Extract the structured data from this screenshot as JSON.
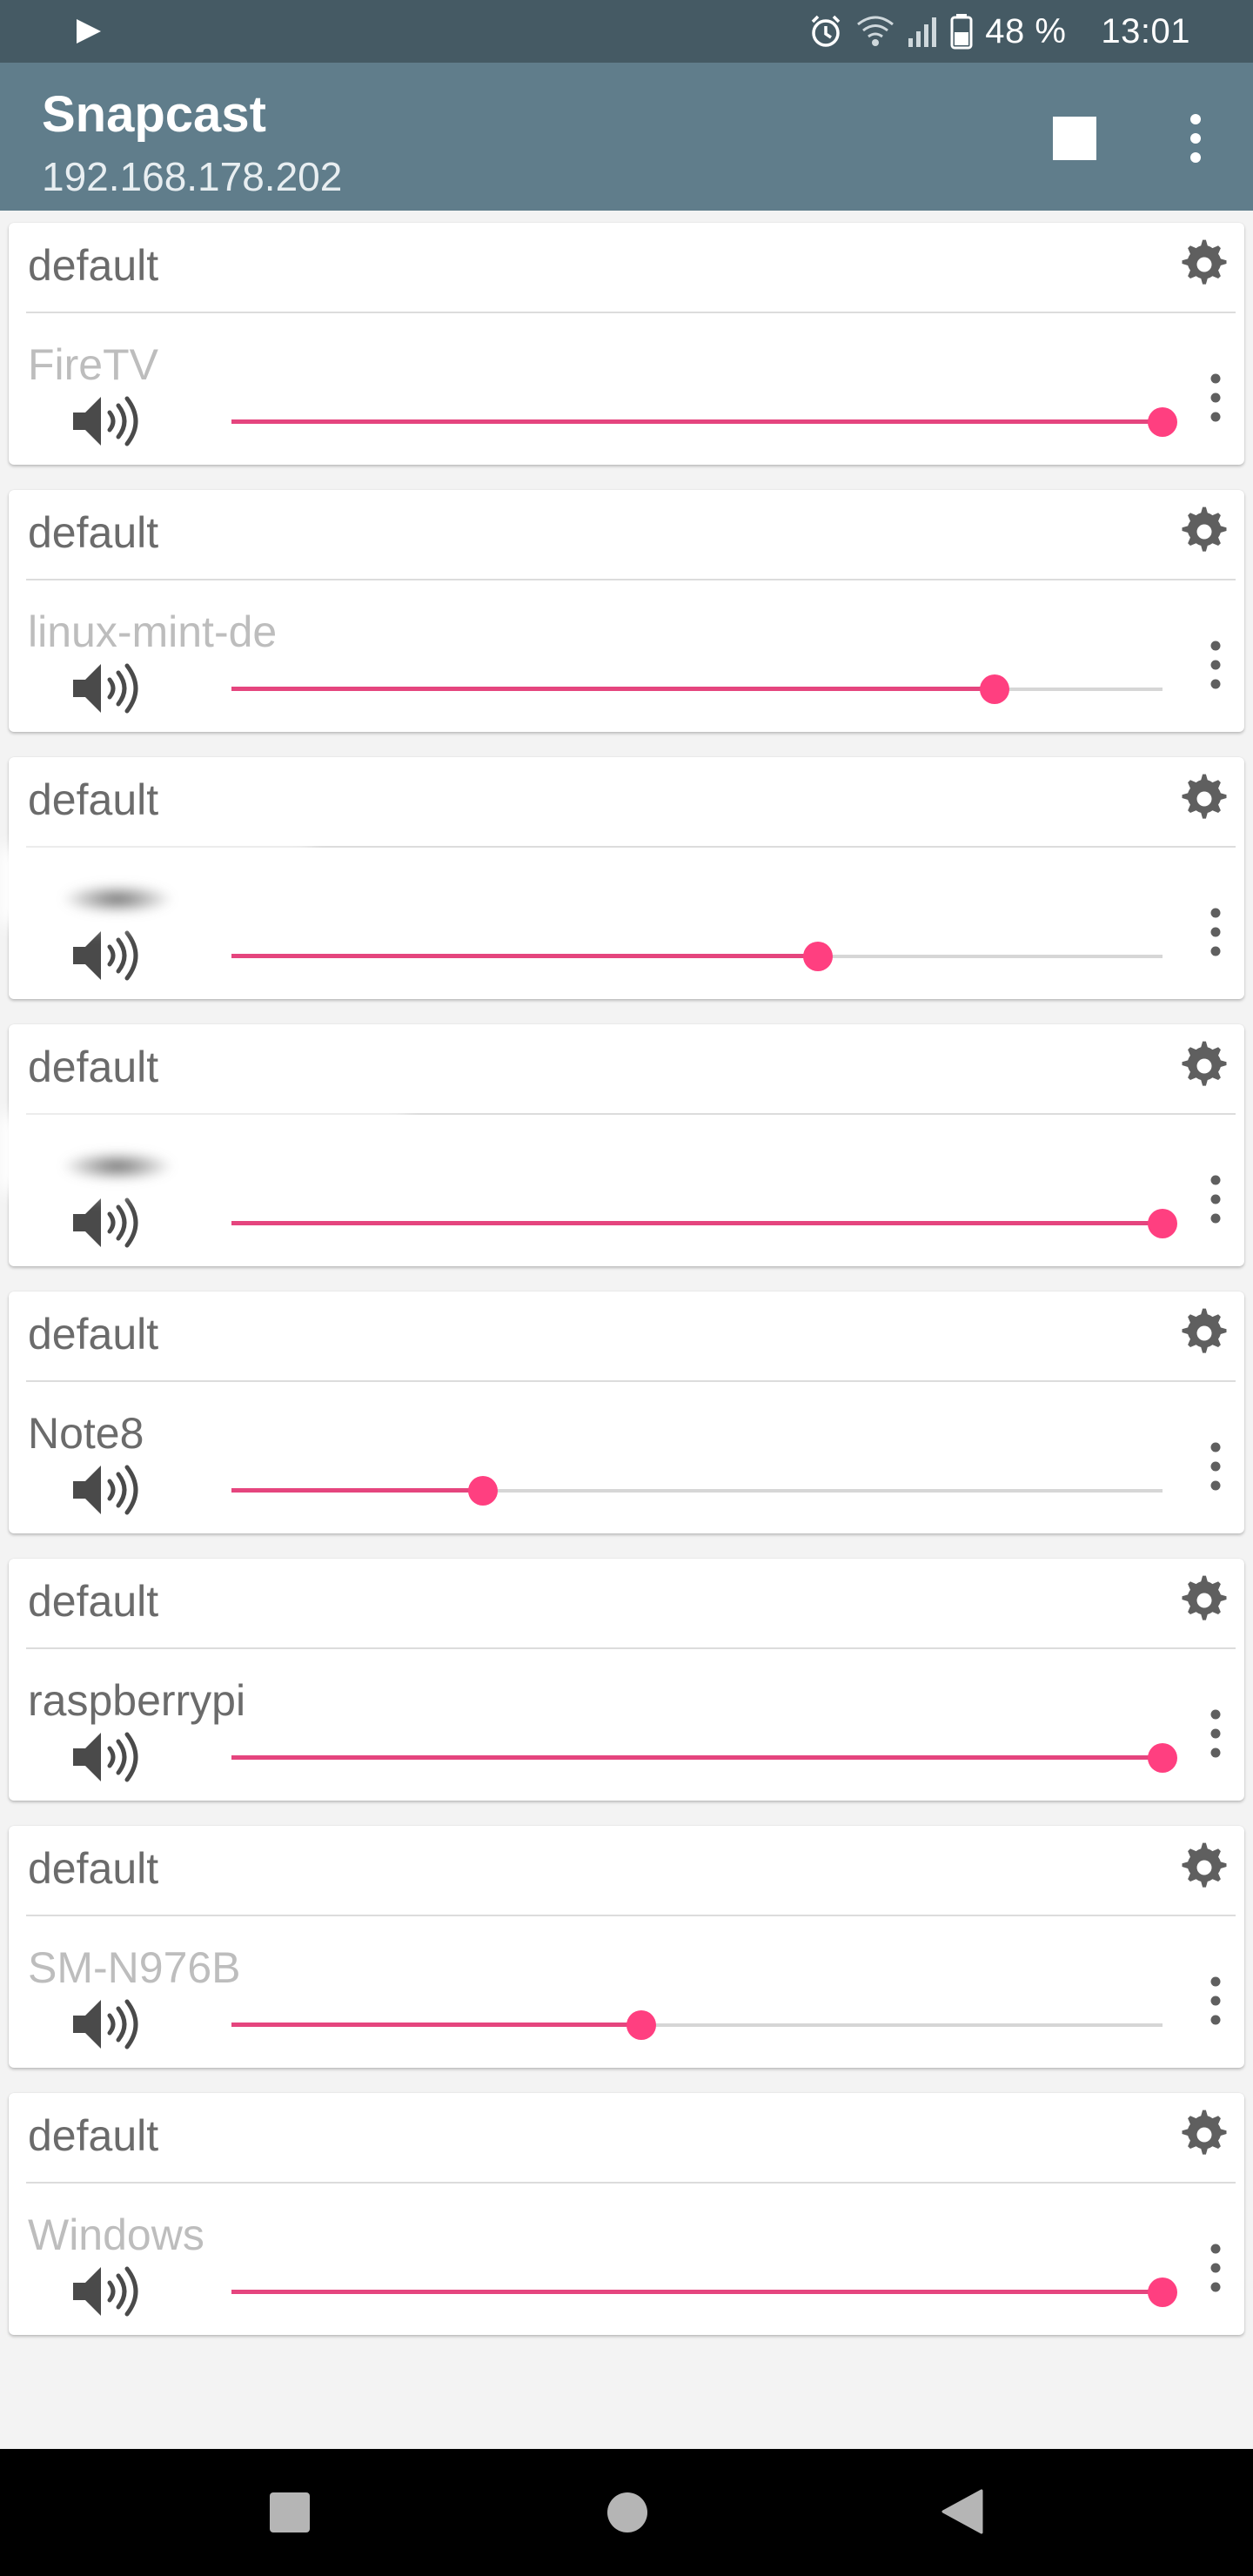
{
  "status_bar": {
    "battery_text": "48 %",
    "time": "13:01",
    "icons": [
      "play-icon",
      "alarm-icon",
      "wifi-icon",
      "signal-icon",
      "battery-icon"
    ]
  },
  "app_bar": {
    "title": "Snapcast",
    "subtitle": "192.168.178.202",
    "actions": [
      "stop-icon",
      "overflow-menu-icon"
    ]
  },
  "groups": [
    {
      "group_name": "default",
      "client_name": "FireTV",
      "client_connected": false,
      "volume": 1.0
    },
    {
      "group_name": "default",
      "client_name": "linux-mint-de",
      "client_connected": false,
      "volume": 0.82
    },
    {
      "group_name": "default",
      "client_name": "",
      "client_connected": false,
      "volume": 0.63,
      "name_obscured": true
    },
    {
      "group_name": "default",
      "client_name": "",
      "client_connected": false,
      "volume": 1.0,
      "name_obscured": true
    },
    {
      "group_name": "default",
      "client_name": "Note8",
      "client_connected": true,
      "volume": 0.27
    },
    {
      "group_name": "default",
      "client_name": "raspberrypi",
      "client_connected": true,
      "volume": 1.0
    },
    {
      "group_name": "default",
      "client_name": "SM-N976B",
      "client_connected": false,
      "volume": 0.44
    },
    {
      "group_name": "default",
      "client_name": "Windows",
      "client_connected": false,
      "volume": 1.0
    }
  ],
  "colors": {
    "status_bar": "#455a64",
    "app_bar": "#607d8b",
    "accent": "#ff3f80",
    "background": "#f3f3f3"
  },
  "nav_bar": {
    "buttons": [
      "recents-icon",
      "home-icon",
      "back-icon"
    ]
  }
}
